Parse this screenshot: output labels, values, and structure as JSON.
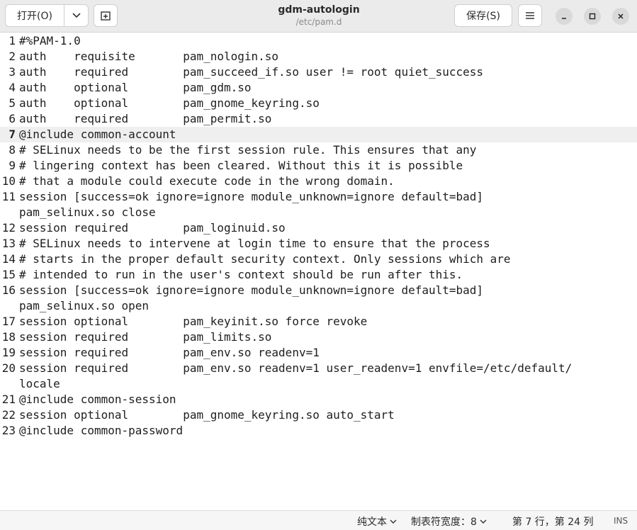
{
  "header": {
    "open_label": "打开(O)",
    "save_label": "保存(S)",
    "title": "gdm-autologin",
    "subtitle": "/etc/pam.d"
  },
  "editor": {
    "current_line": 7,
    "rows": [
      {
        "n": "1",
        "text": "#%PAM-1.0"
      },
      {
        "n": "2",
        "text": "auth    requisite       pam_nologin.so"
      },
      {
        "n": "3",
        "text": "auth    required        pam_succeed_if.so user != root quiet_success"
      },
      {
        "n": "4",
        "text": "auth    optional        pam_gdm.so"
      },
      {
        "n": "5",
        "text": "auth    optional        pam_gnome_keyring.so"
      },
      {
        "n": "6",
        "text": "auth    required        pam_permit.so"
      },
      {
        "n": "7",
        "text": "@include common-account"
      },
      {
        "n": "8",
        "text": "# SELinux needs to be the first session rule. This ensures that any"
      },
      {
        "n": "9",
        "text": "# lingering context has been cleared. Without this it is possible"
      },
      {
        "n": "10",
        "text": "# that a module could execute code in the wrong domain."
      },
      {
        "n": "11",
        "text": "session [success=ok ignore=ignore module_unknown=ignore default=bad]"
      },
      {
        "n": "",
        "text": "pam_selinux.so close"
      },
      {
        "n": "12",
        "text": "session required        pam_loginuid.so"
      },
      {
        "n": "13",
        "text": "# SELinux needs to intervene at login time to ensure that the process"
      },
      {
        "n": "14",
        "text": "# starts in the proper default security context. Only sessions which are"
      },
      {
        "n": "15",
        "text": "# intended to run in the user's context should be run after this."
      },
      {
        "n": "16",
        "text": "session [success=ok ignore=ignore module_unknown=ignore default=bad]"
      },
      {
        "n": "",
        "text": "pam_selinux.so open"
      },
      {
        "n": "17",
        "text": "session optional        pam_keyinit.so force revoke"
      },
      {
        "n": "18",
        "text": "session required        pam_limits.so"
      },
      {
        "n": "19",
        "text": "session required        pam_env.so readenv=1"
      },
      {
        "n": "20",
        "text": "session required        pam_env.so readenv=1 user_readenv=1 envfile=/etc/default/"
      },
      {
        "n": "",
        "text": "locale"
      },
      {
        "n": "21",
        "text": "@include common-session"
      },
      {
        "n": "22",
        "text": "session optional        pam_gnome_keyring.so auto_start"
      },
      {
        "n": "23",
        "text": "@include common-password"
      }
    ]
  },
  "statusbar": {
    "language": "纯文本",
    "tab_width": "制表符宽度：8",
    "position": "第 7 行，第 24 列",
    "mode": "INS"
  }
}
